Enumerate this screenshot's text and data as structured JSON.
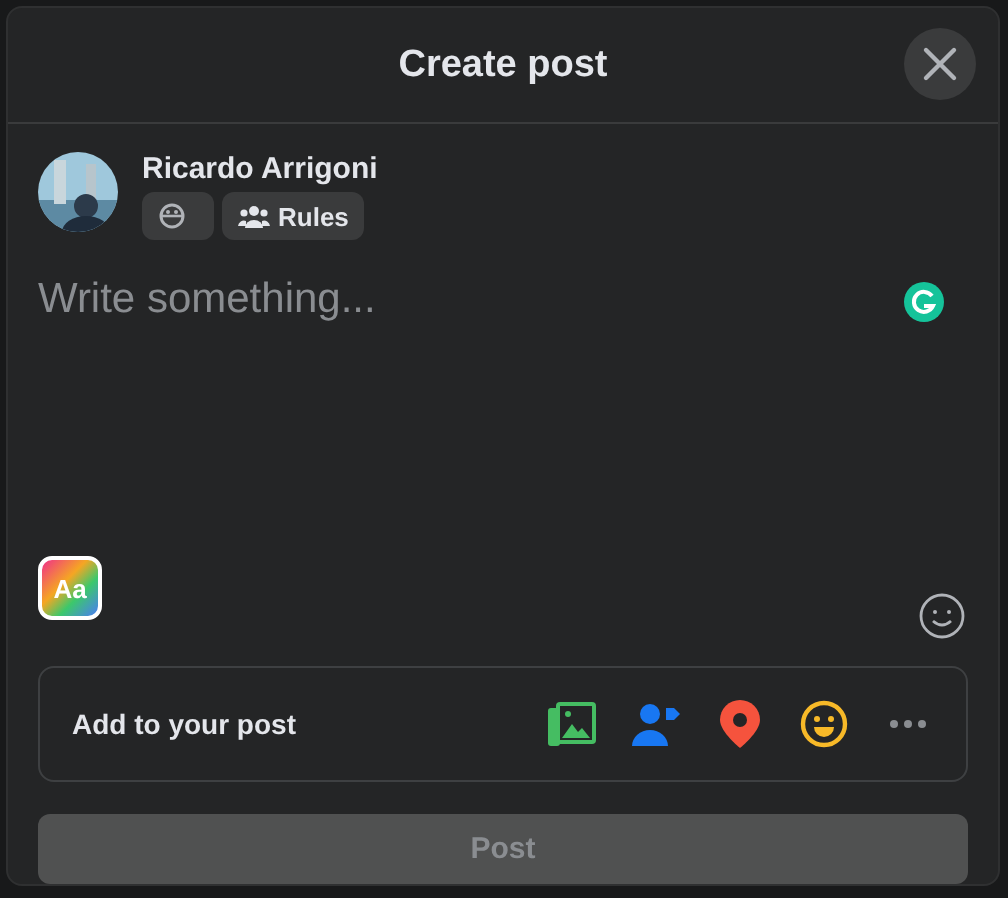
{
  "dialog": {
    "title": "Create post"
  },
  "author": {
    "name": "Ricardo Arrigoni",
    "audience_label": "Rules"
  },
  "composer": {
    "placeholder": "Write something...",
    "background_button": "Aa"
  },
  "add_to_post": {
    "label": "Add to your post"
  },
  "post_button": {
    "label": "Post",
    "disabled": true
  }
}
